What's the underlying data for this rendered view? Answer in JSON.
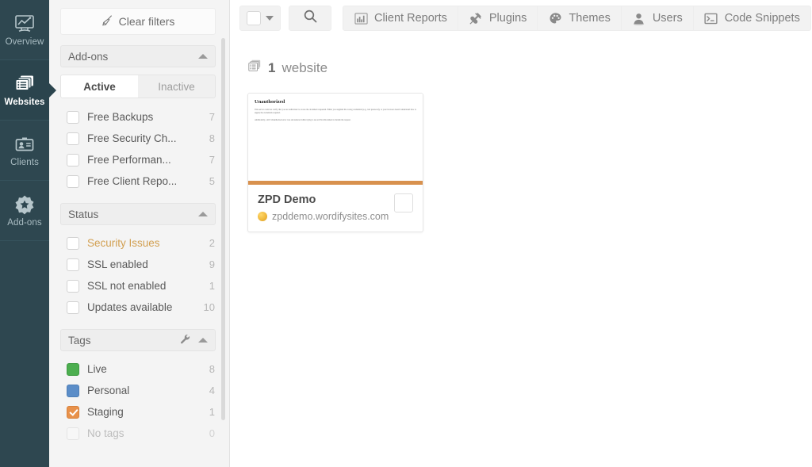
{
  "rail": {
    "items": [
      {
        "label": "Overview",
        "icon": "monitor-chart-icon",
        "active": false
      },
      {
        "label": "Websites",
        "icon": "stacked-list-icon",
        "active": true
      },
      {
        "label": "Clients",
        "icon": "id-card-icon",
        "active": false
      },
      {
        "label": "Add-ons",
        "icon": "star-badge-icon",
        "active": false
      }
    ]
  },
  "filters": {
    "clear_label": "Clear filters",
    "clear_icon": "broom-icon",
    "sections": {
      "addons": {
        "title": "Add-ons",
        "toggle": {
          "active_label": "Active",
          "inactive_label": "Inactive",
          "selected": "Active"
        },
        "items": [
          {
            "label": "Free Backups",
            "count": "7",
            "checked": false
          },
          {
            "label": "Free Security Ch...",
            "count": "8",
            "checked": false
          },
          {
            "label": "Free Performan...",
            "count": "7",
            "checked": false
          },
          {
            "label": "Free Client Repo...",
            "count": "5",
            "checked": false
          }
        ]
      },
      "status": {
        "title": "Status",
        "items": [
          {
            "label": "Security Issues",
            "count": "2",
            "checked": false,
            "style": "warn"
          },
          {
            "label": "SSL enabled",
            "count": "9",
            "checked": false,
            "style": ""
          },
          {
            "label": "SSL not enabled",
            "count": "1",
            "checked": false,
            "style": ""
          },
          {
            "label": "Updates available",
            "count": "10",
            "checked": false,
            "style": ""
          }
        ]
      },
      "tags": {
        "title": "Tags",
        "tools_icon": "wrench-icon",
        "items": [
          {
            "label": "Live",
            "count": "8",
            "checked": false,
            "color": "tag-green",
            "style": ""
          },
          {
            "label": "Personal",
            "count": "4",
            "checked": false,
            "color": "tag-blue",
            "style": ""
          },
          {
            "label": "Staging",
            "count": "1",
            "checked": true,
            "color": "tag-orange",
            "style": ""
          },
          {
            "label": "No tags",
            "count": "0",
            "checked": false,
            "color": "tag-empty",
            "style": "muted"
          }
        ]
      }
    }
  },
  "toolbar": {
    "select_all_icon": "checkbox-dropdown-icon",
    "search_icon": "search-icon",
    "items": [
      {
        "label": "Client Reports",
        "icon": "bar-chart-icon"
      },
      {
        "label": "Plugins",
        "icon": "plug-icon"
      },
      {
        "label": "Themes",
        "icon": "palette-icon"
      },
      {
        "label": "Users",
        "icon": "user-icon"
      },
      {
        "label": "Code Snippets",
        "icon": "terminal-icon"
      }
    ]
  },
  "content": {
    "count_icon": "websites-stack-icon",
    "count_number": "1",
    "count_noun": "website",
    "card": {
      "thumbnail": {
        "heading": "Unauthorized",
        "paragraph1": "This server could not verify that you are authorized to access the document requested. Either you supplied the wrong credentials (e.g., bad password), or your browser doesn't understand how to supply the credentials required.",
        "paragraph2": "Additionally, a 401 Unauthorized error was encountered while trying to use an ErrorDocument to handle the request."
      },
      "accent_color": "#d8914e",
      "title": "ZPD Demo",
      "url": "zpddemo.wordifysites.com",
      "favicon": "globe-favicon"
    }
  }
}
